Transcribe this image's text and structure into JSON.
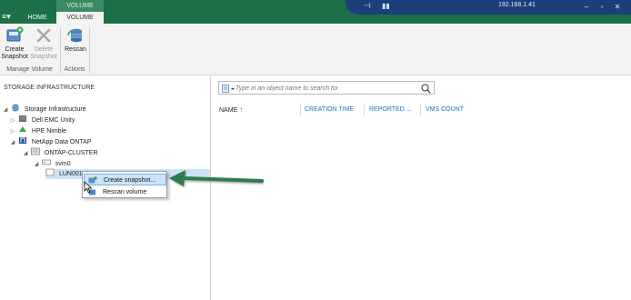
{
  "titlebar": {
    "menu_glyph": "≡▾",
    "contextual_tab_group": "VOLUME TOOLS",
    "tabs": [
      {
        "label": "HOME",
        "active": false
      },
      {
        "label": "VOLUME",
        "active": true
      }
    ],
    "remote_session": {
      "ip": "192.168.1.41",
      "pin_icon": "pin-icon",
      "signal_icon": "signal-icon"
    },
    "accent": "#1c6f46"
  },
  "ribbon": {
    "buttons": [
      {
        "label_line1": "Create",
        "label_line2": "Snapshot",
        "icon": "create-snapshot-icon",
        "enabled": true
      },
      {
        "label_line1": "Delete",
        "label_line2": "Snapshot",
        "icon": "delete-snapshot-icon",
        "enabled": false
      },
      {
        "label_line1": "Rescan",
        "label_line2": "",
        "icon": "rescan-icon",
        "enabled": true
      }
    ],
    "groups": [
      "Manage Volume",
      "Actions"
    ]
  },
  "left_panel": {
    "header": "STORAGE INFRASTRUCTURE",
    "tree": [
      {
        "label": "Storage Infrastructure",
        "icon": "storage-infrastructure-icon",
        "expanded": true
      },
      {
        "label": "Dell EMC Unity",
        "icon": "storage-array-icon",
        "expanded": false
      },
      {
        "label": "HPE Nimble",
        "icon": "nimble-icon",
        "expanded": false
      },
      {
        "label": "NetApp Data ONTAP",
        "icon": "netapp-icon",
        "expanded": true
      },
      {
        "label": "ONTAP-CLUSTER",
        "icon": "cluster-icon",
        "expanded": true
      },
      {
        "label": "svm0",
        "icon": "svm-icon",
        "expanded": true
      },
      {
        "label": "LUN001",
        "icon": "volume-icon",
        "selected": true
      }
    ]
  },
  "context_menu": {
    "items": [
      {
        "label": "Create snapshot...",
        "icon": "create-snapshot-icon",
        "highlighted": true
      },
      {
        "label": "Rescan volume",
        "icon": "rescan-icon",
        "highlighted": false
      }
    ]
  },
  "main": {
    "search_placeholder": "Type in an object name to search for",
    "columns": [
      {
        "label": "NAME",
        "sort": "ascending"
      },
      {
        "label": "CREATION TIME"
      },
      {
        "label": "REPORTED ..."
      },
      {
        "label": "VMS COUNT"
      }
    ],
    "sort_glyph": "↑"
  },
  "annotation_arrow_color": "#2e7a4e"
}
